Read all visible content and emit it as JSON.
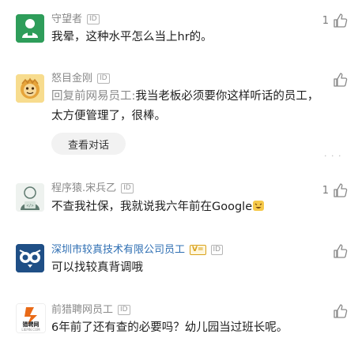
{
  "comments": [
    {
      "username": "守望者",
      "tag": "ID",
      "text": "我晕，这种水平怎么当上hr的。",
      "likes": "1",
      "avatar_color": "#2e9d5a"
    },
    {
      "username": "怒目金刚",
      "tag": "ID",
      "reply_prefix": "回复前网易员工:",
      "text": "我当老板必须要你这样听话的员工，太方便管理了，很棒。",
      "likes": "",
      "view_conversation": "查看对话",
      "avatar_color": "#f4d27a"
    },
    {
      "username": "程序猿.宋兵乙",
      "tag": "ID",
      "text": "不查我社保，我就说我六年前在Google",
      "likes": "1",
      "avatar_color": "#eef2ef"
    },
    {
      "username": "深圳市较真技术有限公司员工",
      "verified_badge": "V=",
      "tag": "ID",
      "text": "可以找较真背调哦",
      "likes": "",
      "avatar_color": "#1f4f86",
      "username_color": "#2f6fb3"
    },
    {
      "username": "前猎聘网员工",
      "tag": "ID",
      "text": "6年前了还有查的必要吗？幼儿园当过班长呢。",
      "likes": "",
      "avatar_logo_text": "猎聘网",
      "avatar_logo_subtext": "LIEPIN.COM",
      "avatar_color": "#e96a17"
    }
  ],
  "icons": {
    "like": "thumbs-up-icon",
    "more": "more-dots-icon"
  }
}
